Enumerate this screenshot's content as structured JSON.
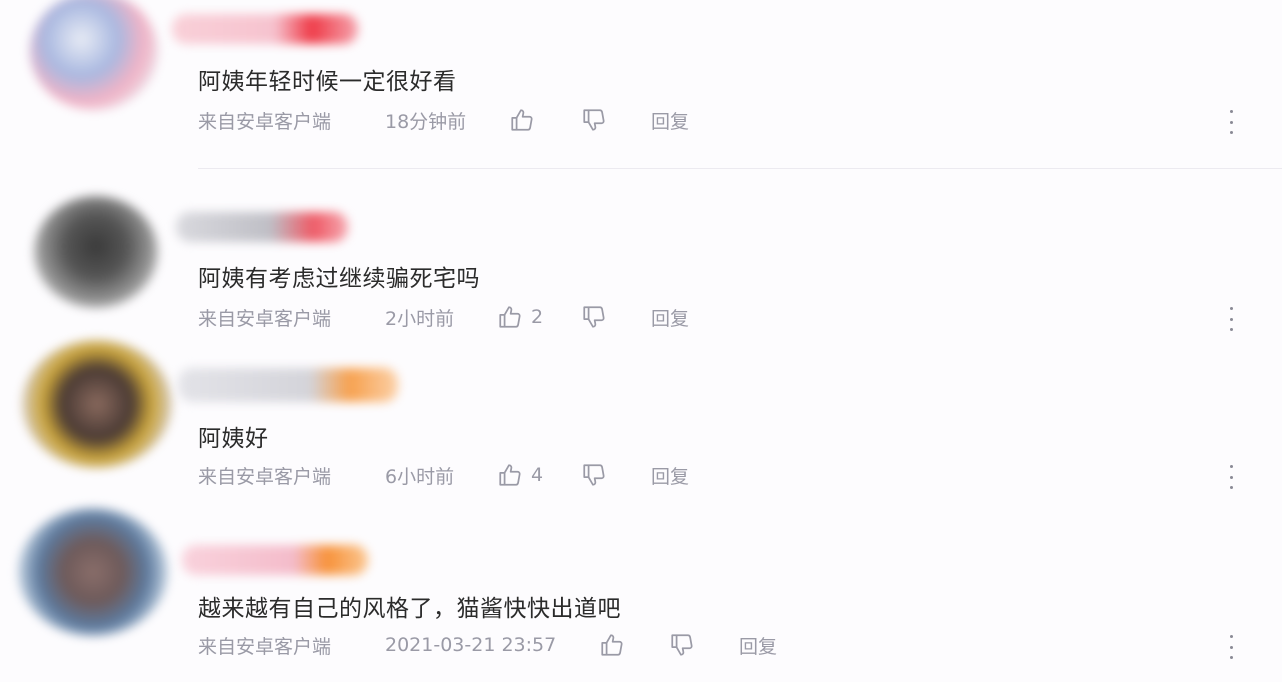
{
  "colors": {
    "background": "#fdfcfe",
    "meta_text": "#9a9aa6",
    "comment_text": "#2b2b2b"
  },
  "icons": {
    "like": "thumbs-up-icon",
    "dislike": "thumbs-down-icon",
    "more": "more-vertical-icon"
  },
  "comments": [
    {
      "text": "阿姨年轻时候一定很好看",
      "source": "来自安卓客户端",
      "time": "18分钟前",
      "likes": "",
      "reply_label": "回复"
    },
    {
      "text": "阿姨有考虑过继续骗死宅吗",
      "source": "来自安卓客户端",
      "time": "2小时前",
      "likes": "2",
      "reply_label": "回复"
    },
    {
      "text": "阿姨好",
      "source": "来自安卓客户端",
      "time": "6小时前",
      "likes": "4",
      "reply_label": "回复"
    },
    {
      "text": "越来越有自己的风格了，猫酱快快出道吧",
      "source": "来自安卓客户端",
      "time": "2021-03-21 23:57",
      "likes": "",
      "reply_label": "回复"
    }
  ]
}
